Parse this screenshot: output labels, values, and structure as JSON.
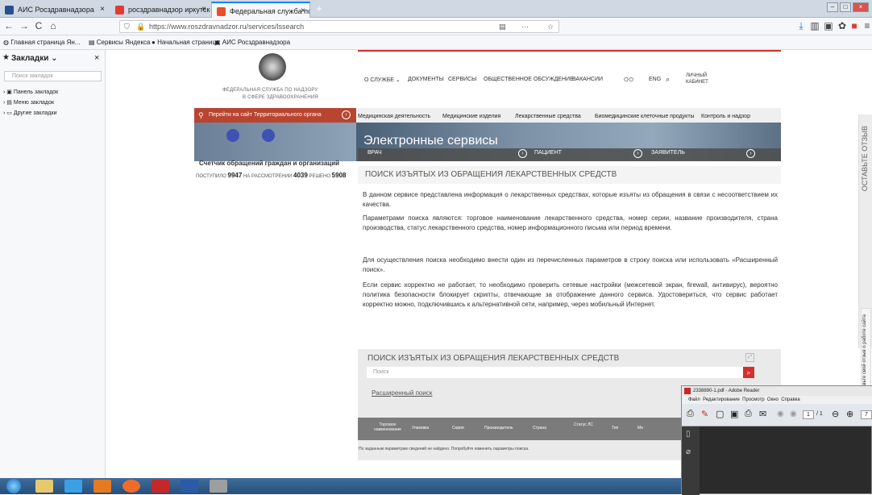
{
  "tabs": [
    {
      "title": "АИС Росздравнадзора",
      "color": "#2a4f8f",
      "active": false
    },
    {
      "title": "росздравнадзор иркутской об",
      "color": "#e53935",
      "active": false
    },
    {
      "title": "Федеральная служба по надз",
      "color": "#e8502a",
      "active": true
    }
  ],
  "nav": {
    "url": "https://www.roszdravnadzor.ru/services/lssearch",
    "back": "←",
    "forward": "→",
    "reload": "C",
    "home": "⌂",
    "more": "···"
  },
  "bookmarks_bar": [
    "Главная страница Ян...",
    "Сервисы Яндекса",
    "Начальная страница",
    "АИС Росздравнадзора"
  ],
  "sidebar": {
    "title": "Закладки",
    "close": "×",
    "search_placeholder": "Поиск закладок",
    "items": [
      "Панель закладок",
      "Меню закладок",
      "Другие закладки"
    ]
  },
  "site": {
    "org_line1": "ФЕДЕРАЛЬНАЯ СЛУЖБА ПО НАДЗОРУ",
    "org_line2": "В СФЕРЕ ЗДРАВООХРАНЕНИЯ",
    "topnav": [
      "О СЛУЖБЕ",
      "ДОКУМЕНТЫ",
      "СЕРВИСЫ",
      "ОБЩЕСТВЕННОЕ ОБСУЖДЕНИЕ",
      "ВАКАНСИИ"
    ],
    "lang": "ENG",
    "cabinet": "ЛИЧНЫЙ КАБИНЕТ",
    "redbtn": "Перейти на сайт Территориального органа",
    "graynav": [
      "Медицинская деятельность",
      "Медицинские изделия",
      "Лекарственные средства",
      "Биомедицинские клеточные продукты",
      "Контроль и надзор"
    ],
    "banner_title": "Электронные сервисы",
    "counter_title": "Счетчик обращений граждан и организаций",
    "counter": {
      "received_label": "ПОСТУПИЛО",
      "received": "9947",
      "review_label": "НА РАССМОТРЕНИИ",
      "review": "4039",
      "solved_label": "РЕШЕНО",
      "solved": "5908"
    },
    "roles": [
      "ВРАЧ",
      "ПАЦИЕНТ",
      "ЗАЯВИТЕЛЬ"
    ],
    "section_title": "ПОИСК ИЗЪЯТЫХ ИЗ ОБРАЩЕНИЯ ЛЕКАРСТВЕННЫХ СРЕДСТВ",
    "paragraphs": [
      "В данном сервисе представлена информация о лекарственных средствах, которые изъяты из обращения в связи с несоответствием их качества.",
      "Параметрами поиска являются: торговое наименование лекарственного средства, номер серии, название производителя, страна производства, статус лекарственного средства, номер информационного письма или период времени.",
      "Для осуществления поиска необходимо внести один из перечисленных параметров в строку поиска или использовать «Расширенный поиск».",
      "Если сервис корректно не работает, то необходимо проверить сетевые настройки (межсетевой экран, firewall, антивирус), вероятно политика безопасности блокирует скрипты, отвечающие за отображение данного сервиса. Удостовериться, что сервис работает корректно можно, подключившись к альтернативной сети, например, через мобильный Интернет."
    ],
    "search_title": "ПОИСК ИЗЪЯТЫХ ИЗ ОБРАЩЕНИЯ ЛЕКАРСТВЕННЫХ СРЕДСТВ",
    "search_placeholder": "Поиск",
    "advanced": "Расширенный поиск",
    "table_cols": [
      "Торговое наименование",
      "Упаковка",
      "Серия",
      "Производитель",
      "Страна",
      "Статус ЛС",
      "Тип",
      "Ме"
    ],
    "no_results": "По заданным параметрам сведений не найдено. Попробуйте изменить параметры поиска.",
    "feedback": "ОСТАВЬТЕ ОТЗЫВ",
    "feedback2": "Оставьте свой отзыв о работе сайта",
    "feedback_badge": "008"
  },
  "reader": {
    "title": "2338890-1.pdf - Adobe Reader",
    "menu": [
      "Файл",
      "Редактирование",
      "Просмотр",
      "Окно",
      "Справка"
    ],
    "page": "1",
    "pages": "/ 1",
    "zoom": "7"
  }
}
